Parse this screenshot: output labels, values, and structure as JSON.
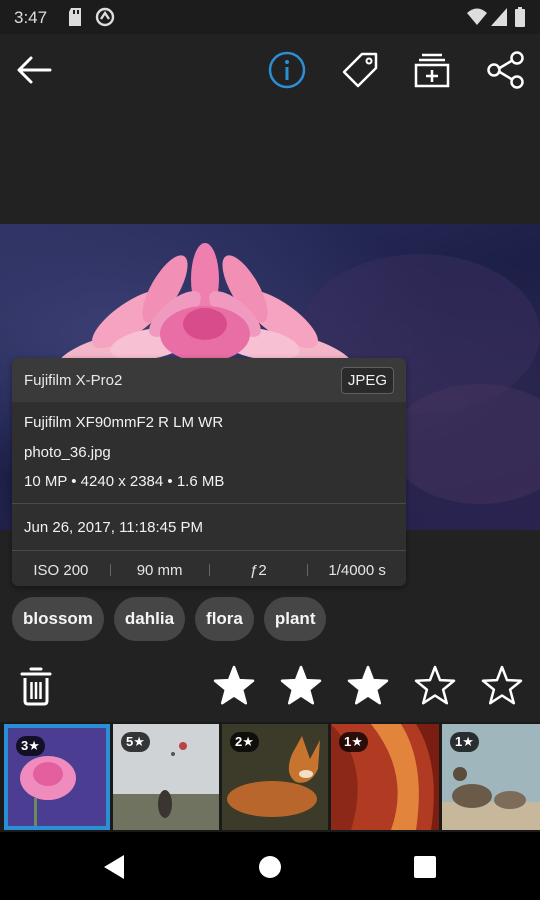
{
  "status_bar": {
    "time": "3:47",
    "icons": [
      "sd-card-icon",
      "sync-icon",
      "wifi-icon",
      "signal-icon",
      "battery-icon"
    ]
  },
  "toolbar": {
    "icons": [
      "back-arrow-icon",
      "info-icon",
      "tag-icon",
      "add-to-album-icon",
      "share-icon"
    ],
    "accent_color": "#2b8fd6"
  },
  "info": {
    "camera": "Fujifilm X-Pro2",
    "format": "JPEG",
    "lens": "Fujifilm XF90mmF2 R LM WR",
    "filename": "photo_36.jpg",
    "specs": "10 MP • 4240 x 2384 • 1.6 MB",
    "date": "Jun 26, 2017, 11:18:45 PM",
    "iso": "ISO 200",
    "focal_length": "90 mm",
    "aperture": "ƒ2",
    "shutter": "1/4000 s"
  },
  "tags": [
    "blossom",
    "dahlia",
    "flora",
    "plant"
  ],
  "rating": {
    "value": 3,
    "max": 5
  },
  "filmstrip": [
    {
      "badge": "3★",
      "selected": true
    },
    {
      "badge": "5★",
      "selected": false
    },
    {
      "badge": "2★",
      "selected": false
    },
    {
      "badge": "1★",
      "selected": false
    },
    {
      "badge": "1★",
      "selected": false
    }
  ],
  "nav_bar": {
    "icons": [
      "back-triangle-icon",
      "home-circle-icon",
      "recents-square-icon"
    ]
  }
}
